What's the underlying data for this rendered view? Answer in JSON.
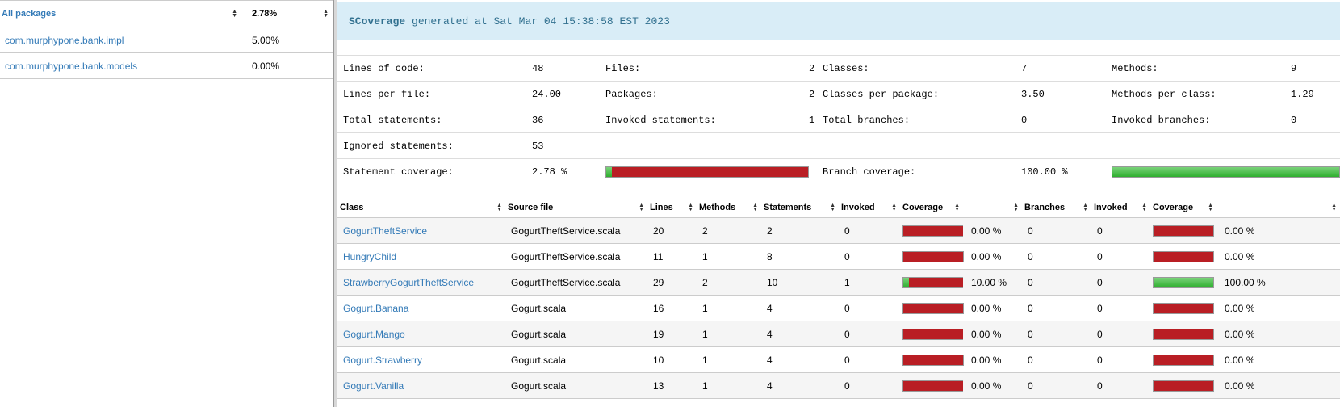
{
  "packages": {
    "header_name": "All packages",
    "header_pct": "2.78%",
    "items": [
      {
        "name": "com.murphypone.bank.impl",
        "pct": "5.00%"
      },
      {
        "name": "com.murphypone.bank.models",
        "pct": "0.00%"
      }
    ]
  },
  "banner": {
    "brand": "SCoverage",
    "text": "generated at Sat Mar 04 15:38:58 EST 2023"
  },
  "stats": {
    "lines_of_code_label": "Lines of code:",
    "lines_of_code": "48",
    "files_label": "Files:",
    "files": "2",
    "classes_label": "Classes:",
    "classes": "7",
    "methods_label": "Methods:",
    "methods": "9",
    "lines_per_file_label": "Lines per file:",
    "lines_per_file": "24.00",
    "packages_label": "Packages:",
    "packages": "2",
    "classes_per_package_label": "Classes per package:",
    "classes_per_package": "3.50",
    "methods_per_class_label": "Methods per class:",
    "methods_per_class": "1.29",
    "total_statements_label": "Total statements:",
    "total_statements": "36",
    "invoked_statements_label": "Invoked statements:",
    "invoked_statements": "1",
    "total_branches_label": "Total branches:",
    "total_branches": "0",
    "invoked_branches_label": "Invoked branches:",
    "invoked_branches": "0",
    "ignored_statements_label": "Ignored statements:",
    "ignored_statements": "53",
    "statement_coverage_label": "Statement coverage:",
    "statement_coverage": "2.78 %",
    "statement_coverage_fraction": 0.0278,
    "branch_coverage_label": "Branch coverage:",
    "branch_coverage": "100.00 %",
    "branch_coverage_fraction": 1.0
  },
  "class_table": {
    "headers": [
      "Class",
      "Source file",
      "Lines",
      "Methods",
      "Statements",
      "Invoked",
      "Coverage",
      "",
      "Branches",
      "Invoked",
      "Coverage",
      ""
    ],
    "rows": [
      {
        "cls": "GogurtTheftService",
        "file": "GogurtTheftService.scala",
        "lines": "20",
        "methods": "2",
        "statements": "2",
        "invoked": "0",
        "stmt_cov": "0.00 %",
        "stmt_frac": 0,
        "branches": "0",
        "b_invoked": "0",
        "branch_cov": "0.00 %",
        "branch_frac": 0
      },
      {
        "cls": "HungryChild",
        "file": "GogurtTheftService.scala",
        "lines": "11",
        "methods": "1",
        "statements": "8",
        "invoked": "0",
        "stmt_cov": "0.00 %",
        "stmt_frac": 0,
        "branches": "0",
        "b_invoked": "0",
        "branch_cov": "0.00 %",
        "branch_frac": 0
      },
      {
        "cls": "StrawberryGogurtTheftService",
        "file": "GogurtTheftService.scala",
        "lines": "29",
        "methods": "2",
        "statements": "10",
        "invoked": "1",
        "stmt_cov": "10.00 %",
        "stmt_frac": 0.1,
        "branches": "0",
        "b_invoked": "0",
        "branch_cov": "100.00 %",
        "branch_frac": 1
      },
      {
        "cls": "Gogurt.Banana",
        "file": "Gogurt.scala",
        "lines": "16",
        "methods": "1",
        "statements": "4",
        "invoked": "0",
        "stmt_cov": "0.00 %",
        "stmt_frac": 0,
        "branches": "0",
        "b_invoked": "0",
        "branch_cov": "0.00 %",
        "branch_frac": 0
      },
      {
        "cls": "Gogurt.Mango",
        "file": "Gogurt.scala",
        "lines": "19",
        "methods": "1",
        "statements": "4",
        "invoked": "0",
        "stmt_cov": "0.00 %",
        "stmt_frac": 0,
        "branches": "0",
        "b_invoked": "0",
        "branch_cov": "0.00 %",
        "branch_frac": 0
      },
      {
        "cls": "Gogurt.Strawberry",
        "file": "Gogurt.scala",
        "lines": "10",
        "methods": "1",
        "statements": "4",
        "invoked": "0",
        "stmt_cov": "0.00 %",
        "stmt_frac": 0,
        "branches": "0",
        "b_invoked": "0",
        "branch_cov": "0.00 %",
        "branch_frac": 0
      },
      {
        "cls": "Gogurt.Vanilla",
        "file": "Gogurt.scala",
        "lines": "13",
        "methods": "1",
        "statements": "4",
        "invoked": "0",
        "stmt_cov": "0.00 %",
        "stmt_frac": 0,
        "branches": "0",
        "b_invoked": "0",
        "branch_cov": "0.00 %",
        "branch_frac": 0
      }
    ]
  },
  "colors": {
    "covered": "#3cb83c",
    "uncovered": "#b91e24",
    "link": "#337ab7",
    "banner": "#d9edf7"
  }
}
